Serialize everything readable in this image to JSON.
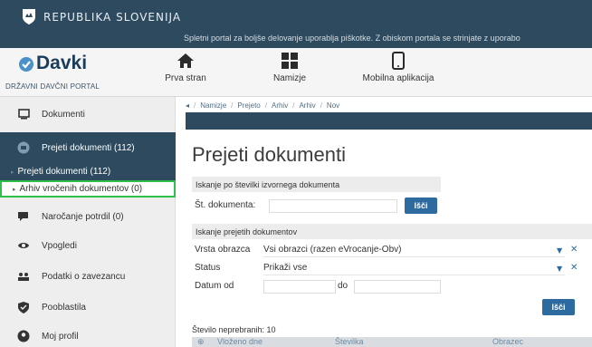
{
  "gov": {
    "name": "REPUBLIKA SLOVENIJA",
    "cookie_text": "Spletni portal za boljše delovanje uporablja piškotke. Z obiskom portala se strinjate z uporabo"
  },
  "header": {
    "logo": "Davki",
    "logo_sub": "DRŽAVNI DAVČNI PORTAL",
    "nav": [
      {
        "label": "Prva stran",
        "icon": "home-icon"
      },
      {
        "label": "Namizje",
        "icon": "dashboard-icon"
      },
      {
        "label": "Mobilna aplikacija",
        "icon": "mobile-icon"
      }
    ]
  },
  "sidebar": {
    "items": [
      {
        "label": "Dokumenti",
        "icon": "document-icon"
      },
      {
        "label": "Prejeti dokumenti (112)",
        "icon": "inbox-icon"
      },
      {
        "label": "Naročanje potrdil (0)",
        "icon": "chat-icon"
      },
      {
        "label": "Vpogledi",
        "icon": "eye-icon"
      },
      {
        "label": "Podatki o zavezancu",
        "icon": "users-icon"
      },
      {
        "label": "Pooblastila",
        "icon": "shield-icon"
      },
      {
        "label": "Moj profil",
        "icon": "profile-icon"
      }
    ],
    "subitems": [
      {
        "label": "Prejeti dokumenti (112)"
      },
      {
        "label": "Arhiv vročenih dokumentov (0)"
      }
    ]
  },
  "breadcrumb": [
    "Namizje",
    "Prejeto",
    "Arhiv",
    "Arhiv",
    "Nov"
  ],
  "main": {
    "title": "Prejeti dokumenti",
    "search1": {
      "heading": "Iskanje po številki izvornega dokumenta",
      "label": "Št. dokumenta:",
      "button": "Išči"
    },
    "search2": {
      "heading": "Iskanje prejetih dokumentov",
      "vrsta_label": "Vrsta obrazca",
      "vrsta_value": "Vsi obrazci (razen eVrocanje-Obv)",
      "status_label": "Status",
      "status_value": "Prikaži vse",
      "datum_label": "Datum od",
      "do_label": "do",
      "button": "Išči"
    },
    "count": "Število neprebranih: 10",
    "columns": [
      "Vloženo dne",
      "Številka",
      "Obrazec"
    ]
  }
}
